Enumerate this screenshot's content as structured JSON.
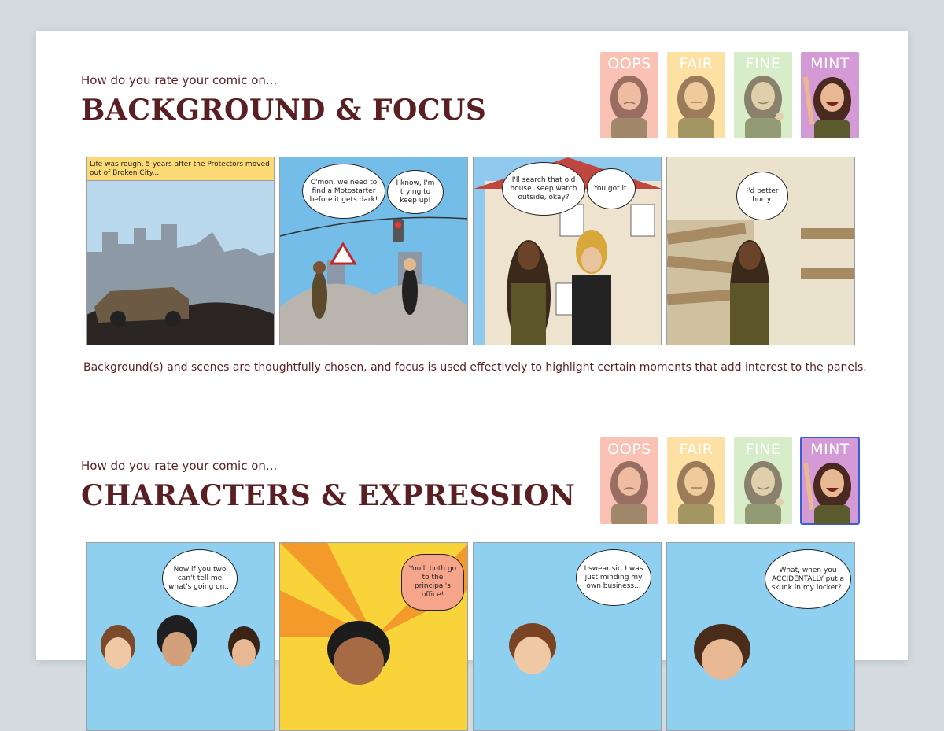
{
  "colors": {
    "heading": "#5a1f23",
    "oops": "#f9c2b4",
    "fair": "#fde0a4",
    "fine": "#d7ecc8",
    "mint": "#d49ad6",
    "selected_outline": "#3b5ed6"
  },
  "rating_labels": [
    "OOPS",
    "FAIR",
    "FINE",
    "MINT"
  ],
  "sections": [
    {
      "kicker": "How do you rate your comic on...",
      "title": "BACKGROUND & FOCUS",
      "selected_rating": "MINT",
      "panels": [
        {
          "caption": "Life was rough, 5 years after the Protectors moved out of Broken City...",
          "bubbles": []
        },
        {
          "caption": "",
          "bubbles": [
            "C'mon, we need to find a Motostarter before it gets dark!",
            "I know, I'm trying to keep up!"
          ]
        },
        {
          "caption": "",
          "bubbles": [
            "I'll search that old house. Keep watch outside, okay?",
            "You got it."
          ]
        },
        {
          "caption": "",
          "bubbles": [
            "I'd better hurry."
          ]
        }
      ],
      "description": "Background(s) and scenes are thoughtfully chosen, and focus is used effectively to highlight certain moments that add interest to the panels."
    },
    {
      "kicker": "How do you rate your comic on...",
      "title": "CHARACTERS & EXPRESSION",
      "selected_rating": "MINT",
      "panels": [
        {
          "caption": "",
          "bubbles": [
            "Now if you two can't tell me what's going on..."
          ]
        },
        {
          "caption": "",
          "bubbles": [
            "You'll both go to the principal's office!"
          ]
        },
        {
          "caption": "",
          "bubbles": [
            "I swear sir, I was just minding my own business..."
          ]
        },
        {
          "caption": "",
          "bubbles": [
            "What, when you ACCIDENTALLY put a skunk in my locker?!"
          ]
        }
      ]
    }
  ]
}
